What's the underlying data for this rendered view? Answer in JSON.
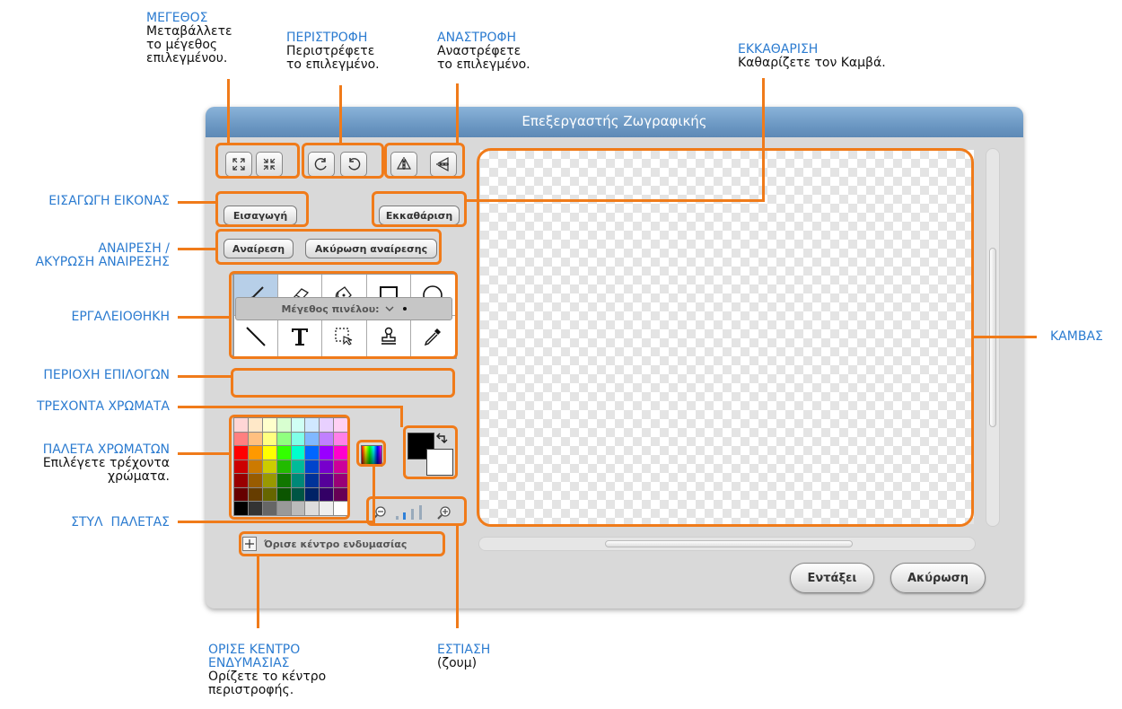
{
  "window": {
    "title": "Επεξεργαστής Ζωγραφικής"
  },
  "buttons": {
    "import": "Εισαγωγή",
    "clear": "Εκκαθάριση",
    "undo": "Αναίρεση",
    "redo": "Ακύρωση αναίρεσης",
    "set_center": "Όρισε κέντρο ενδυμασίας",
    "ok": "Εντάξει",
    "cancel": "Ακύρωση"
  },
  "options": {
    "brush_size_label": "Μέγεθος πινέλου:"
  },
  "tools": [
    "paintbrush-icon",
    "eraser-icon",
    "fill-bucket-icon",
    "rectangle-icon",
    "ellipse-icon",
    "line-icon",
    "text-icon",
    "select-icon",
    "stamp-icon",
    "eyedropper-icon"
  ],
  "colors": {
    "foreground": "#000000",
    "background": "#ffffff",
    "accent": "#f07b1a",
    "caption": "#2b7bd0",
    "palette": [
      "#ffd6d6",
      "#ffe8c8",
      "#ffffcc",
      "#d8ffd0",
      "#d0fff4",
      "#d0e8ff",
      "#e8d0ff",
      "#ffd0f4",
      "#ff8080",
      "#ffc080",
      "#ffff80",
      "#90ff80",
      "#80ffe8",
      "#80b8ff",
      "#c080ff",
      "#ff80e8",
      "#ff0000",
      "#ff9900",
      "#ffff00",
      "#33ff00",
      "#00ffcc",
      "#0066ff",
      "#9900ff",
      "#ff00cc",
      "#cc0000",
      "#cc7a00",
      "#cccc00",
      "#22bb00",
      "#00bb99",
      "#0044cc",
      "#7700cc",
      "#cc0099",
      "#990000",
      "#995c00",
      "#999900",
      "#117700",
      "#008877",
      "#003399",
      "#550099",
      "#990077",
      "#660000",
      "#663d00",
      "#666600",
      "#0b5500",
      "#005544",
      "#002266",
      "#330066",
      "#660055",
      "#000000",
      "#333333",
      "#666666",
      "#999999",
      "#bbbbbb",
      "#dddddd",
      "#eeeeee",
      "#ffffff"
    ]
  },
  "annotations": {
    "size": {
      "title": "ΜΕΓΕΘΟΣ",
      "desc": [
        "Μεταβάλλετε",
        "το μέγεθος",
        "επιλεγμένου."
      ]
    },
    "rotate": {
      "title": "ΠΕΡΙΣΤΡΟΦΗ",
      "desc": [
        "Περιστρέφετε",
        "το επιλεγμένο."
      ]
    },
    "flip": {
      "title": "ΑΝΑΣΤΡΟΦΗ",
      "desc": [
        "Αναστρέφετε",
        "το επιλεγμένο."
      ]
    },
    "clear": {
      "title": "ΕΚΚΑΘΑΡΙΣΗ",
      "desc": [
        "Καθαρίζετε τον Καμβά."
      ]
    },
    "import": {
      "title": "ΕΙΣΑΓΩΓΗ ΕΙΚΟΝΑΣ"
    },
    "undo": {
      "title": [
        "ΑΝΑΙΡΕΣΗ /",
        "ΑΚΥΡΩΣΗ ΑΝΑΙΡΕΣΗΣ"
      ]
    },
    "toolbar": {
      "title": "ΕΡΓΑΛΕΙΟΘΗΚΗ"
    },
    "options": {
      "title": "ΠΕΡΙΟΧΗ ΕΠΙΛΟΓΩΝ"
    },
    "current_colors": {
      "title": "ΤΡΕΧΟΝΤΑ ΧΡΩΜΑΤΑ"
    },
    "palette": {
      "title": "ΠΑΛΕΤΑ ΧΡΩΜΑΤΩΝ",
      "desc": [
        "Επιλέγετε τρέχοντα",
        "χρώματα."
      ]
    },
    "palette_style": {
      "title": "ΣΤΥΛ  ΠΑΛΕΤΑΣ"
    },
    "canvas": {
      "title": "ΚΑΜΒΑΣ"
    },
    "set_center": {
      "title": [
        "ΟΡΙΣΕ ΚΕΝΤΡΟ",
        "ΕΝΔΥΜΑΣΙΑΣ"
      ],
      "desc": [
        "Ορίζετε το κέντρο",
        "περιστροφής."
      ]
    },
    "zoom": {
      "title": "ΕΣΤΙΑΣΗ",
      "desc": [
        "(ζουμ)"
      ]
    }
  }
}
